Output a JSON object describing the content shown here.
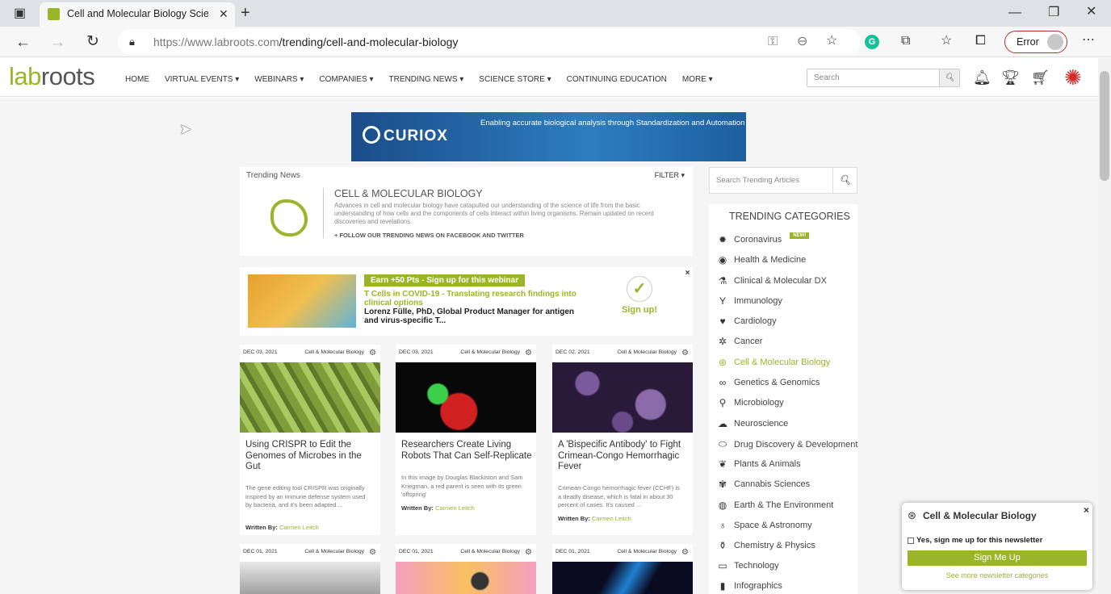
{
  "browser": {
    "tab_title": "Cell and Molecular Biology Scien",
    "url_host": "https://www.labroots.com",
    "url_path": "/trending/cell-and-molecular-biology",
    "error_label": "Error"
  },
  "site": {
    "logo_part1": "lab",
    "logo_part2": "roots",
    "menu": [
      "HOME",
      "VIRTUAL EVENTS ▾",
      "WEBINARS ▾",
      "COMPANIES ▾",
      "TRENDING NEWS ▾",
      "SCIENCE STORE ▾",
      "CONTINUING EDUCATION",
      "MORE ▾"
    ],
    "search_placeholder": "Search"
  },
  "banner": {
    "brand": "CURIOX",
    "tagline": "Enabling accurate biological analysis through Standardization and Automation"
  },
  "trending": {
    "label": "Trending News",
    "filter": "FILTER ▾",
    "title": "CELL & MOLECULAR BIOLOGY",
    "description": "Advances in cell and molecular biology have catapulted our understanding of the science of life from the basic understanding of how cells and the components of cells interact within living organisms. Remain updated on recent discoveries and revelations.",
    "follow": "+ FOLLOW OUR TRENDING NEWS ON FACEBOOK AND TWITTER"
  },
  "webinar": {
    "earn": "Earn +50 Pts - Sign up for this webinar",
    "title": "T Cells in COVID-19 - Translating research findings into clinical options",
    "speaker": "Lorenz Fülle, PhD, Global Product Manager for antigen and virus-specific T...",
    "sign_up": "Sign up!",
    "close": "×"
  },
  "articles": [
    {
      "date": "DEC 03, 2021",
      "category": "Cell & Molecular Biology",
      "title": "Using CRISPR to Edit the Genomes of Microbes in the Gut",
      "desc": "The gene editing tool CRISPR was originally inspired by an immune defense system used by bacteria, and it's been adapted ...",
      "by_label": "Written By:",
      "author": "Carmen Leitch"
    },
    {
      "date": "DEC 03, 2021",
      "category": "Cell & Molecular Biology",
      "title": "Researchers Create Living Robots That Can Self-Replicate",
      "desc": "In this image by Douglas Blackiston and Sam Kriegman, a red parent is seen with its green 'offspring'",
      "by_label": "Written By:",
      "author": "Carmen Leitch"
    },
    {
      "date": "DEC 02, 2021",
      "category": "Cell & Molecular Biology",
      "title": "A 'Bispecific Antibody' to Fight Crimean-Congo Hemorrhagic Fever",
      "desc": "Crimean-Congo hemorrhagic fever (CCHF) is a deadly disease, which is fatal in about 30 percent of cases. It's caused ...",
      "by_label": "Written By:",
      "author": "Carmen Leitch"
    },
    {
      "date": "DEC 01, 2021",
      "category": "Cell & Molecular Biology"
    },
    {
      "date": "DEC 01, 2021",
      "category": "Cell & Molecular Biology"
    },
    {
      "date": "DEC 01, 2021",
      "category": "Cell & Molecular Biology"
    }
  ],
  "sidebar": {
    "search_placeholder": "Search Trending Articles",
    "heading": "TRENDING CATEGORIES",
    "new_badge": "NEW!",
    "categories": [
      {
        "label": "Coronavirus",
        "icon": "virus-icon"
      },
      {
        "label": "Health & Medicine",
        "icon": "eye-icon"
      },
      {
        "label": "Clinical & Molecular DX",
        "icon": "test-tube-icon"
      },
      {
        "label": "Immunology",
        "icon": "antibody-icon"
      },
      {
        "label": "Cardiology",
        "icon": "heart-icon"
      },
      {
        "label": "Cancer",
        "icon": "cell-icon"
      },
      {
        "label": "Cell & Molecular Biology",
        "icon": "cell-biology-icon"
      },
      {
        "label": "Genetics & Genomics",
        "icon": "dna-icon"
      },
      {
        "label": "Microbiology",
        "icon": "microscope-icon"
      },
      {
        "label": "Neuroscience",
        "icon": "brain-icon"
      },
      {
        "label": "Drug Discovery & Development",
        "icon": "pill-icon"
      },
      {
        "label": "Plants & Animals",
        "icon": "plant-icon"
      },
      {
        "label": "Cannabis Sciences",
        "icon": "leaf-icon"
      },
      {
        "label": "Earth & The Environment",
        "icon": "globe-icon"
      },
      {
        "label": "Space & Astronomy",
        "icon": "planet-icon"
      },
      {
        "label": "Chemistry & Physics",
        "icon": "flask-icon"
      },
      {
        "label": "Technology",
        "icon": "monitor-icon"
      },
      {
        "label": "Infographics",
        "icon": "chart-icon"
      }
    ]
  },
  "newsletter": {
    "title": "Cell & Molecular Biology",
    "checkbox": "Yes, sign me up for this newsletter",
    "button": "Sign Me Up",
    "more": "See more newsletter categories",
    "close": "×"
  },
  "colors": {
    "accent": "#9bb52a",
    "error": "#b03030"
  }
}
